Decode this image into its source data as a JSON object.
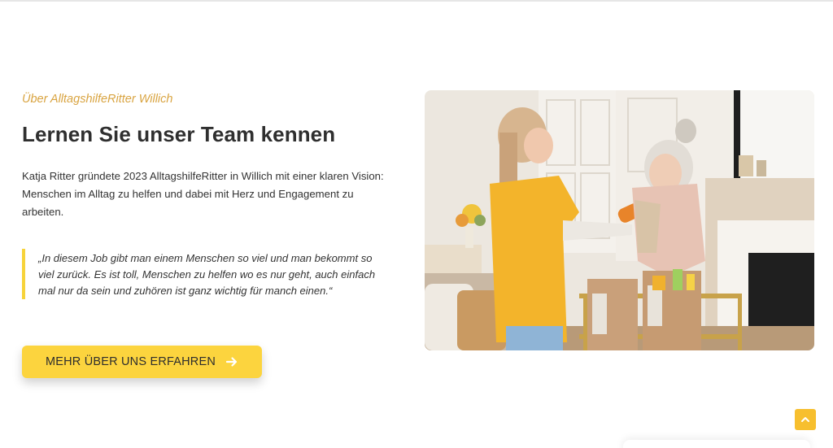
{
  "about": {
    "eyebrow": "Über AlltagshilfeRitter Willich",
    "title": "Lernen Sie unser Team kennen",
    "intro": "Katja Ritter gründete 2023 AlltagshilfeRitter in Willich mit einer klaren Vision: Menschen im Alltag zu helfen und dabei mit Herz und Engagement zu arbeiten.",
    "quote": "„In diesem Job gibt man einem Menschen so viel und man bekommt so viel zurück. Es ist toll, Menschen zu helfen wo es nur geht, auch einfach mal nur da sein und zuhören ist ganz wichtig für manch einen.“",
    "cta_label": "MEHR ÜBER UNS ERFAHREN",
    "cta_icon": "arrow-right-icon"
  },
  "image": {
    "icon": "team-photo"
  },
  "scroll_top": {
    "icon": "chevron-up-icon"
  },
  "colors": {
    "accent_yellow": "#fcd43e",
    "eyebrow_gold": "#d9a441",
    "quote_bar": "#f7d33a",
    "scroll_top_bg": "#f7bf2e"
  }
}
